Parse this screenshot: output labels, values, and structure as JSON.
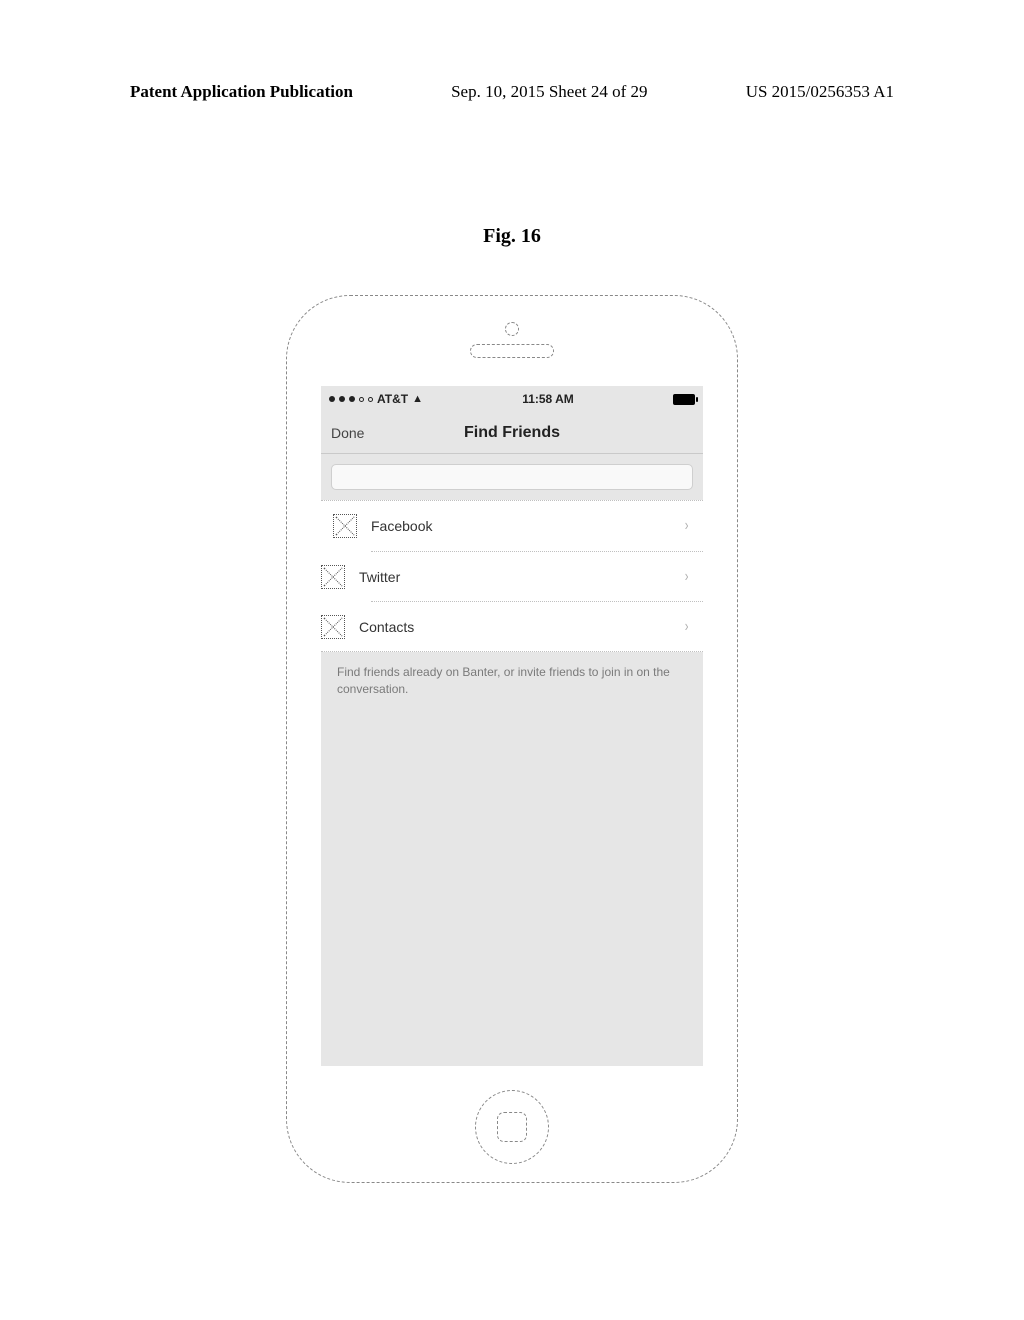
{
  "doc_header": {
    "left": "Patent Application Publication",
    "center": "Sep. 10, 2015  Sheet 24 of 29",
    "right": "US 2015/0256353 A1"
  },
  "figure_caption": "Fig. 16",
  "status_bar": {
    "carrier": "AT&T",
    "time": "11:58 AM"
  },
  "nav": {
    "done_label": "Done",
    "title": "Find Friends"
  },
  "options": [
    {
      "label": "Facebook"
    },
    {
      "label": "Twitter"
    },
    {
      "label": "Contacts"
    }
  ],
  "footer_text": "Find friends already on Banter, or invite friends to join in on the conversation."
}
